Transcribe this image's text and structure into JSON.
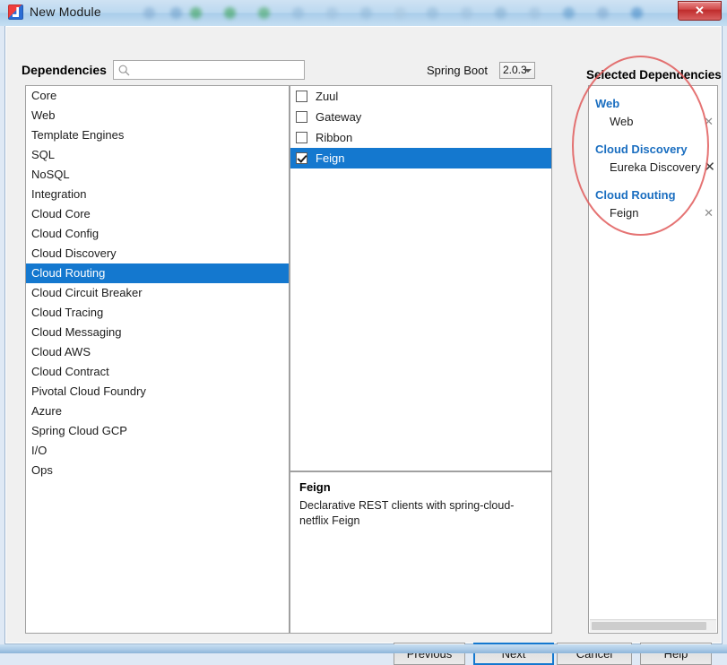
{
  "window": {
    "title": "New Module",
    "icon": "intellij-idea-icon",
    "close_label": "✕"
  },
  "toolbar": {
    "dependencies_label": "Dependencies",
    "search_placeholder": "",
    "search_value": "",
    "search_icon": "search-icon",
    "spring_boot_label": "Spring Boot",
    "spring_boot_version": "2.0.3",
    "selected_dependencies_title": "Selected Dependencies"
  },
  "categories": [
    {
      "label": "Core",
      "selected": false
    },
    {
      "label": "Web",
      "selected": false
    },
    {
      "label": "Template Engines",
      "selected": false
    },
    {
      "label": "SQL",
      "selected": false
    },
    {
      "label": "NoSQL",
      "selected": false
    },
    {
      "label": "Integration",
      "selected": false
    },
    {
      "label": "Cloud Core",
      "selected": false
    },
    {
      "label": "Cloud Config",
      "selected": false
    },
    {
      "label": "Cloud Discovery",
      "selected": false
    },
    {
      "label": "Cloud Routing",
      "selected": true
    },
    {
      "label": "Cloud Circuit Breaker",
      "selected": false
    },
    {
      "label": "Cloud Tracing",
      "selected": false
    },
    {
      "label": "Cloud Messaging",
      "selected": false
    },
    {
      "label": "Cloud AWS",
      "selected": false
    },
    {
      "label": "Cloud Contract",
      "selected": false
    },
    {
      "label": "Pivotal Cloud Foundry",
      "selected": false
    },
    {
      "label": "Azure",
      "selected": false
    },
    {
      "label": "Spring Cloud GCP",
      "selected": false
    },
    {
      "label": "I/O",
      "selected": false
    },
    {
      "label": "Ops",
      "selected": false
    }
  ],
  "dependencies": [
    {
      "label": "Zuul",
      "checked": false,
      "selected": false
    },
    {
      "label": "Gateway",
      "checked": false,
      "selected": false
    },
    {
      "label": "Ribbon",
      "checked": false,
      "selected": false
    },
    {
      "label": "Feign",
      "checked": true,
      "selected": true
    }
  ],
  "description": {
    "title": "Feign",
    "text": "Declarative REST clients with spring-cloud-netflix Feign"
  },
  "selected_dependencies": [
    {
      "group": "Web",
      "items": [
        {
          "label": "Web",
          "remove": "✕"
        }
      ]
    },
    {
      "group": "Cloud Discovery",
      "items": [
        {
          "label": "Eureka Discovery",
          "remove": "✕"
        }
      ]
    },
    {
      "group": "Cloud Routing",
      "items": [
        {
          "label": "Feign",
          "remove": "✕"
        }
      ]
    }
  ],
  "buttons": {
    "previous": "Previous",
    "next": "Next",
    "cancel": "Cancel",
    "help": "Help"
  },
  "colors": {
    "selection_blue": "#1478cf",
    "group_header_blue": "#1a6ec0",
    "annotation_red": "#e05a5a",
    "close_red": "#bf2b2b"
  }
}
